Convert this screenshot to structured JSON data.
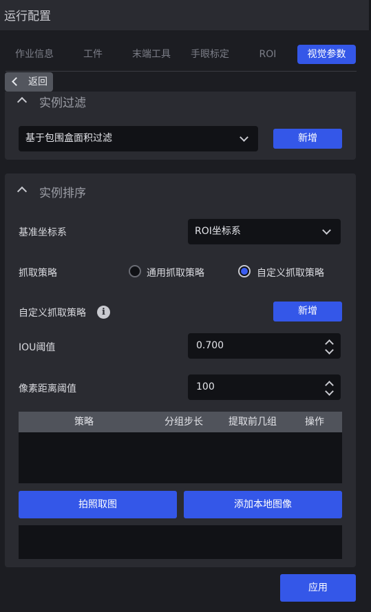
{
  "window": {
    "title": "运行配置"
  },
  "tabs": [
    {
      "label": "作业信息",
      "active": false
    },
    {
      "label": "工件",
      "active": false
    },
    {
      "label": "末端工具",
      "active": false
    },
    {
      "label": "手眼标定",
      "active": false
    },
    {
      "label": "ROI",
      "active": false
    },
    {
      "label": "视觉参数",
      "active": true
    }
  ],
  "back": {
    "label": "返回"
  },
  "instance_filter": {
    "title": "实例过滤",
    "select_value": "基于包围盒面积过滤",
    "add_label": "新增"
  },
  "instance_sort": {
    "title": "实例排序",
    "base_coord": {
      "label": "基准坐标系",
      "value": "ROI坐标系"
    },
    "grab_strategy": {
      "label": "抓取策略",
      "options": [
        {
          "label": "通用抓取策略",
          "selected": false
        },
        {
          "label": "自定义抓取策略",
          "selected": true
        }
      ]
    },
    "custom_strategy": {
      "label": "自定义抓取策略",
      "add_label": "新增",
      "icon": "info-icon"
    },
    "iou": {
      "label": "IOU阈值",
      "value": "0.700"
    },
    "pixel_dist": {
      "label": "像素距离阈值",
      "value": "100"
    },
    "table": {
      "columns": [
        "策略",
        "分组步长",
        "提取前几组",
        "操作"
      ],
      "rows": []
    },
    "capture_label": "拍照取图",
    "add_local_label": "添加本地图像"
  },
  "apply_label": "应用",
  "colors": {
    "accent": "#3457e8",
    "panel": "#2a2b31",
    "background": "#1c1d22",
    "input": "#111216"
  }
}
